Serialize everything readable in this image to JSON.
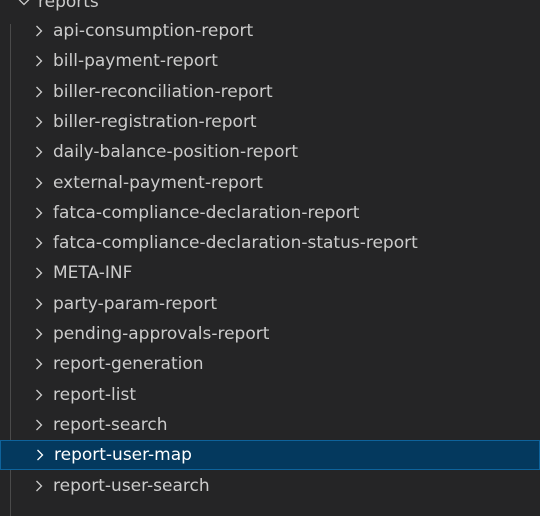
{
  "explorer": {
    "root": {
      "label": "reports",
      "icon": "chevron-down-icon"
    },
    "items": [
      {
        "label": "api-consumption-report",
        "icon": "chevron-right-icon",
        "selected": false
      },
      {
        "label": "bill-payment-report",
        "icon": "chevron-right-icon",
        "selected": false
      },
      {
        "label": "biller-reconciliation-report",
        "icon": "chevron-right-icon",
        "selected": false
      },
      {
        "label": "biller-registration-report",
        "icon": "chevron-right-icon",
        "selected": false
      },
      {
        "label": "daily-balance-position-report",
        "icon": "chevron-right-icon",
        "selected": false
      },
      {
        "label": "external-payment-report",
        "icon": "chevron-right-icon",
        "selected": false
      },
      {
        "label": "fatca-compliance-declaration-report",
        "icon": "chevron-right-icon",
        "selected": false
      },
      {
        "label": "fatca-compliance-declaration-status-report",
        "icon": "chevron-right-icon",
        "selected": false
      },
      {
        "label": "META-INF",
        "icon": "chevron-right-icon",
        "selected": false
      },
      {
        "label": "party-param-report",
        "icon": "chevron-right-icon",
        "selected": false
      },
      {
        "label": "pending-approvals-report",
        "icon": "chevron-right-icon",
        "selected": false
      },
      {
        "label": "report-generation",
        "icon": "chevron-right-icon",
        "selected": false
      },
      {
        "label": "report-list",
        "icon": "chevron-right-icon",
        "selected": false
      },
      {
        "label": "report-search",
        "icon": "chevron-right-icon",
        "selected": false
      },
      {
        "label": "report-user-map",
        "icon": "chevron-right-icon",
        "selected": true
      },
      {
        "label": "report-user-search",
        "icon": "chevron-right-icon",
        "selected": false
      }
    ],
    "colors": {
      "background": "#252526",
      "text": "#cccccc",
      "selected_background": "#04395e",
      "selected_border": "#0e639c",
      "indent_guide": "#4a4a4a"
    }
  }
}
